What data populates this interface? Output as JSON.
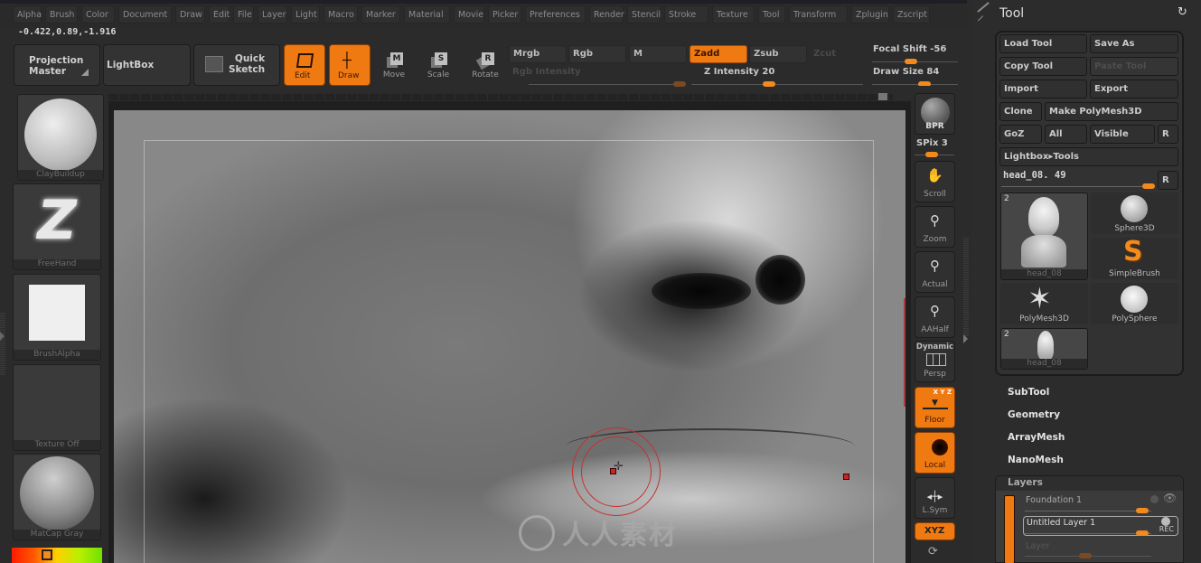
{
  "menubar": {
    "items": [
      "Alpha",
      "Brush",
      "Color",
      "Document",
      "Draw",
      "Edit",
      "File",
      "Layer",
      "Light",
      "Macro",
      "Marker",
      "Material",
      "Movie",
      "Picker",
      "Preferences",
      "Render",
      "Stencil",
      "Stroke",
      "Texture",
      "Tool",
      "Transform",
      "Zplugin",
      "Zscript"
    ]
  },
  "coords": "-0.422,0.89,-1.916",
  "toolbar": {
    "projection_master": "Projection\nMaster",
    "lightbox": "LightBox",
    "quick_sketch": "Quick\nSketch",
    "edit": "Edit",
    "draw": "Draw",
    "move": "Move",
    "move_key": "M",
    "scale": "Scale",
    "scale_key": "S",
    "rotate": "Rotate",
    "rotate_key": "R",
    "mrgb": "Mrgb",
    "rgb": "Rgb",
    "m": "M",
    "zadd": "Zadd",
    "zsub": "Zsub",
    "zcut": "Zcut",
    "rgb_intensity": "Rgb Intensity",
    "z_intensity": "Z Intensity 20",
    "focal_shift": "Focal Shift -56",
    "draw_size": "Draw Size 84",
    "sliders": {
      "z_intensity": 20,
      "focal_shift": -56,
      "draw_size": 84
    }
  },
  "left_shelf": {
    "brush": "ClayBuildup",
    "stroke": "FreeHand",
    "alpha": "BrushAlpha",
    "texture": "Texture Off",
    "material": "MatCap Gray"
  },
  "colors": {
    "accent": "#f07a12",
    "panel_bg": "#2b2b2b",
    "brush_ring": "#c43030"
  },
  "viewport": {
    "watermark": "人人素材"
  },
  "right_strip": {
    "bpr": "BPR",
    "spix": "SPix 3",
    "scroll": "Scroll",
    "zoom": "Zoom",
    "actual": "Actual",
    "aahalf": "AAHalf",
    "dynamic": "Dynamic",
    "persp": "Persp",
    "xyz_small": "X Y Z",
    "floor": "Floor",
    "local": "Local",
    "lsym": "L.Sym",
    "xyz": "XYZ"
  },
  "tool_panel": {
    "title": "Tool",
    "load_tool": "Load Tool",
    "save_as": "Save As",
    "copy_tool": "Copy Tool",
    "paste_tool": "Paste Tool",
    "import": "Import",
    "export": "Export",
    "clone": "Clone",
    "make_polymesh": "Make PolyMesh3D",
    "goz": "GoZ",
    "all": "All",
    "visible": "Visible",
    "r": "R",
    "lightbox_tools": "Lightbox▸Tools",
    "current_tool": "head_08. 49",
    "tools": [
      {
        "name": "head_08",
        "count": "2"
      },
      {
        "name": "Sphere3D"
      },
      {
        "name": "SimpleBrush"
      },
      {
        "name": "PolyMesh3D"
      },
      {
        "name": "PolySphere"
      },
      {
        "name": "head_08",
        "count": "2"
      }
    ],
    "sections": [
      "SubTool",
      "Geometry",
      "ArrayMesh",
      "NanoMesh"
    ],
    "layers": {
      "title": "Layers",
      "foundation": "Foundation 1",
      "untitled": "Untitled Layer 1",
      "rec": "REC",
      "layer": "Layer"
    }
  }
}
